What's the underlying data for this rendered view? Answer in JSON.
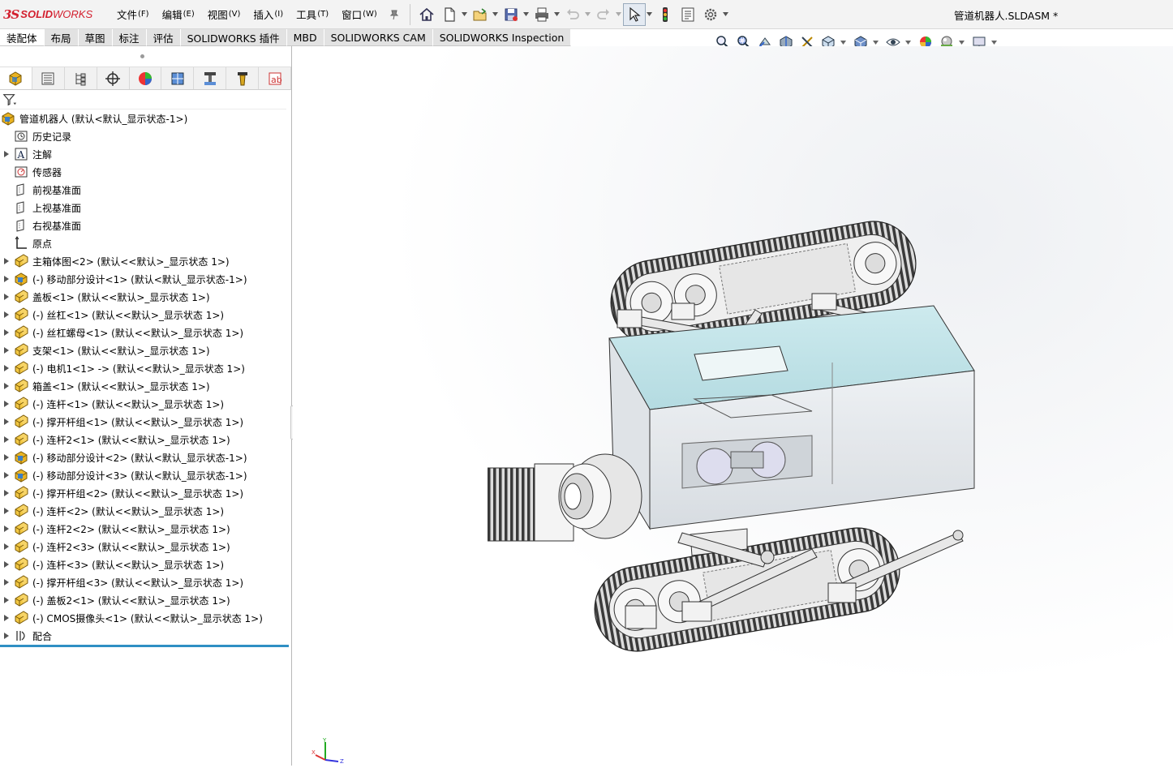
{
  "app": {
    "logo_ds": "3S",
    "logo_text_a": "SOLID",
    "logo_text_b": "WORKS",
    "document_title": "管道机器人.SLDASM *"
  },
  "menu": [
    {
      "label": "文件",
      "key": "(F)"
    },
    {
      "label": "编辑",
      "key": "(E)"
    },
    {
      "label": "视图",
      "key": "(V)"
    },
    {
      "label": "插入",
      "key": "(I)"
    },
    {
      "label": "工具",
      "key": "(T)"
    },
    {
      "label": "窗口",
      "key": "(W)"
    }
  ],
  "command_tabs": [
    "装配体",
    "布局",
    "草图",
    "标注",
    "评估",
    "SOLIDWORKS 插件",
    "MBD",
    "SOLIDWORKS CAM",
    "SOLIDWORKS Inspection"
  ],
  "tree": {
    "root": "管道机器人  (默认<默认_显示状态-1>)",
    "items": [
      {
        "label": "历史记录",
        "icon": "history-icon",
        "expandable": false
      },
      {
        "label": "注解",
        "icon": "annotation-icon",
        "expandable": true
      },
      {
        "label": "传感器",
        "icon": "sensor-icon",
        "expandable": false
      },
      {
        "label": "前视基准面",
        "icon": "plane-icon",
        "expandable": false
      },
      {
        "label": "上视基准面",
        "icon": "plane-icon",
        "expandable": false
      },
      {
        "label": "右视基准面",
        "icon": "plane-icon",
        "expandable": false
      },
      {
        "label": "原点",
        "icon": "origin-icon",
        "expandable": false
      },
      {
        "label": "主箱体图<2> (默认<<默认>_显示状态 1>)",
        "icon": "part-icon",
        "expandable": true
      },
      {
        "label": "(-) 移动部分设计<1> (默认<默认_显示状态-1>)",
        "icon": "assembly-icon",
        "expandable": true
      },
      {
        "label": "盖板<1> (默认<<默认>_显示状态 1>)",
        "icon": "part-icon",
        "expandable": true
      },
      {
        "label": "(-) 丝杠<1> (默认<<默认>_显示状态 1>)",
        "icon": "part-icon",
        "expandable": true
      },
      {
        "label": "(-) 丝杠螺母<1> (默认<<默认>_显示状态 1>)",
        "icon": "part-icon",
        "expandable": true
      },
      {
        "label": "支架<1> (默认<<默认>_显示状态 1>)",
        "icon": "part-icon",
        "expandable": true
      },
      {
        "label": "(-) 电机1<1> -> (默认<<默认>_显示状态 1>)",
        "icon": "part-icon",
        "expandable": true
      },
      {
        "label": "箱盖<1> (默认<<默认>_显示状态 1>)",
        "icon": "part-icon",
        "expandable": true
      },
      {
        "label": "(-) 连杆<1> (默认<<默认>_显示状态 1>)",
        "icon": "part-icon",
        "expandable": true
      },
      {
        "label": "(-) 撑开杆组<1> (默认<<默认>_显示状态 1>)",
        "icon": "part-icon",
        "expandable": true
      },
      {
        "label": "(-) 连杆2<1> (默认<<默认>_显示状态 1>)",
        "icon": "part-icon",
        "expandable": true
      },
      {
        "label": "(-) 移动部分设计<2> (默认<默认_显示状态-1>)",
        "icon": "assembly-icon",
        "expandable": true
      },
      {
        "label": "(-) 移动部分设计<3> (默认<默认_显示状态-1>)",
        "icon": "assembly-icon",
        "expandable": true
      },
      {
        "label": "(-) 撑开杆组<2> (默认<<默认>_显示状态 1>)",
        "icon": "part-icon",
        "expandable": true
      },
      {
        "label": "(-) 连杆<2> (默认<<默认>_显示状态 1>)",
        "icon": "part-icon",
        "expandable": true
      },
      {
        "label": "(-) 连杆2<2> (默认<<默认>_显示状态 1>)",
        "icon": "part-icon",
        "expandable": true
      },
      {
        "label": "(-) 连杆2<3> (默认<<默认>_显示状态 1>)",
        "icon": "part-icon",
        "expandable": true
      },
      {
        "label": "(-) 连杆<3> (默认<<默认>_显示状态 1>)",
        "icon": "part-icon",
        "expandable": true
      },
      {
        "label": "(-) 撑开杆组<3> (默认<<默认>_显示状态 1>)",
        "icon": "part-icon",
        "expandable": true
      },
      {
        "label": "(-) 盖板2<1> (默认<<默认>_显示状态 1>)",
        "icon": "part-icon",
        "expandable": true
      },
      {
        "label": "(-) CMOS摄像头<1> (默认<<默认>_显示状态 1>)",
        "icon": "part-icon",
        "expandable": true
      },
      {
        "label": "配合",
        "icon": "mates-icon",
        "expandable": true
      }
    ]
  },
  "triad": {
    "x": "X",
    "y": "Y",
    "z": "Z"
  },
  "colors": {
    "brand_red": "#d3202f",
    "part_yellow": "#e9b323",
    "assembly_blue": "#3c7fc4",
    "selection_blue": "#2f8fc4",
    "glass_cyan": "#bfe3e8"
  }
}
